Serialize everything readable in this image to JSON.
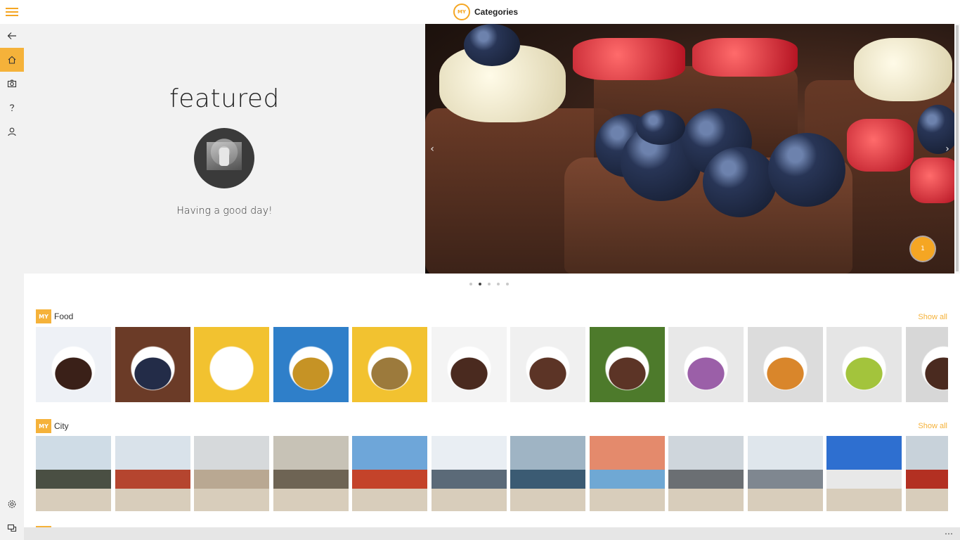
{
  "app": {
    "logo_text": "MY",
    "title": "Categories"
  },
  "nav": {
    "items": [
      {
        "icon": "back-arrow-icon"
      },
      {
        "icon": "home-icon",
        "active": true
      },
      {
        "icon": "camera-icon"
      },
      {
        "icon": "help-icon"
      },
      {
        "icon": "user-icon"
      }
    ],
    "bottom_items": [
      {
        "icon": "settings-icon"
      },
      {
        "icon": "feedback-icon"
      }
    ]
  },
  "featured": {
    "heading": "featured",
    "caption": "Having a good day!",
    "hero_badge": "1",
    "carousel": {
      "count": 5,
      "active_index": 1
    }
  },
  "sections": [
    {
      "badge": "MY",
      "title": "Food",
      "show_all": "Show all",
      "tiles": [
        {
          "bg": "#eef1f6",
          "accent": "#3a2018"
        },
        {
          "bg": "#6b3b27",
          "accent": "#232c48"
        },
        {
          "bg": "#f2c230",
          "accent": "#ffffff"
        },
        {
          "bg": "#2f7fc9",
          "accent": "#c69325"
        },
        {
          "bg": "#f2c230",
          "accent": "#9c7a3c"
        },
        {
          "bg": "#f4f4f4",
          "accent": "#4a2a1f"
        },
        {
          "bg": "#f0f0f0",
          "accent": "#5c3426"
        },
        {
          "bg": "#4d7a2b",
          "accent": "#5c3426"
        },
        {
          "bg": "#e8e8e8",
          "accent": "#9b5fa8"
        },
        {
          "bg": "#dcdcdc",
          "accent": "#d9862b"
        },
        {
          "bg": "#e5e5e5",
          "accent": "#a3c43c"
        },
        {
          "bg": "#d7d7d7",
          "accent": "#4a2a1f"
        }
      ]
    },
    {
      "badge": "MY",
      "title": "City",
      "show_all": "Show all",
      "tiles": [
        {
          "bg": "#cfdce6",
          "accent": "#4a4f43"
        },
        {
          "bg": "#d9e2ea",
          "accent": "#b5452f"
        },
        {
          "bg": "#d6d9db",
          "accent": "#b9a892"
        },
        {
          "bg": "#c7c2b6",
          "accent": "#6e6454"
        },
        {
          "bg": "#6ea6d9",
          "accent": "#c4432a"
        },
        {
          "bg": "#e9eef3",
          "accent": "#5b6a78"
        },
        {
          "bg": "#9fb4c4",
          "accent": "#3b5b73"
        },
        {
          "bg": "#e48a6c",
          "accent": "#6fa8d4"
        },
        {
          "bg": "#cfd6dc",
          "accent": "#6b6f73"
        },
        {
          "bg": "#dfe6ec",
          "accent": "#7f8790"
        },
        {
          "bg": "#2e6fd0",
          "accent": "#e8e8e8"
        },
        {
          "bg": "#c8d2da",
          "accent": "#b33022"
        }
      ]
    }
  ]
}
